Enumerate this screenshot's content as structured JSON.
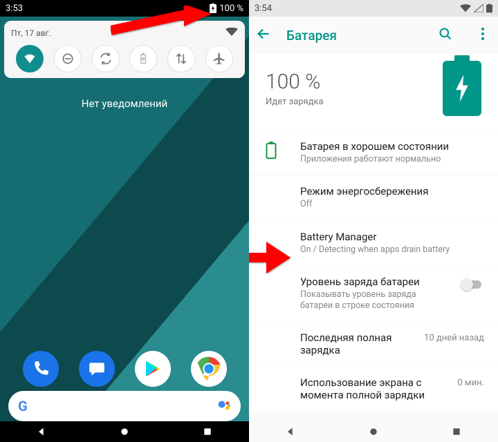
{
  "left": {
    "time": "3:53",
    "battery_label": "100 %",
    "date": "Пт, 17 авг.",
    "no_notifications": "Нет уведомлений",
    "qs": {
      "wifi": "wifi-icon",
      "dnd": "dnd-icon",
      "rotate": "auto-rotate-icon",
      "battery": "battery-saver-icon",
      "data": "mobile-data-icon",
      "airplane": "airplane-icon"
    },
    "dock": {
      "phone": "phone-app-icon",
      "messages": "messages-app-icon",
      "play": "play-store-app-icon",
      "chrome": "chrome-app-icon"
    }
  },
  "right": {
    "time": "3:54",
    "title": "Батарея",
    "percent": "100 %",
    "charging": "Идет зарядка",
    "rows": {
      "health_t": "Батарея в хорошем состоянии",
      "health_s": "Приложения работают нормально",
      "saver_t": "Режим энергосбережения",
      "saver_s": "Off",
      "manager_t": "Battery Manager",
      "manager_s": "On / Detecting when apps drain battery",
      "level_t": "Уровень заряда батареи",
      "level_s": "Показывать уровень заряда батареи в строке состояния",
      "last_t": "Последняя полная зарядка",
      "last_v": "10 дней назад",
      "screen_t": "Использование экрана с момента полной зарядки",
      "screen_v": "0 мин."
    }
  }
}
